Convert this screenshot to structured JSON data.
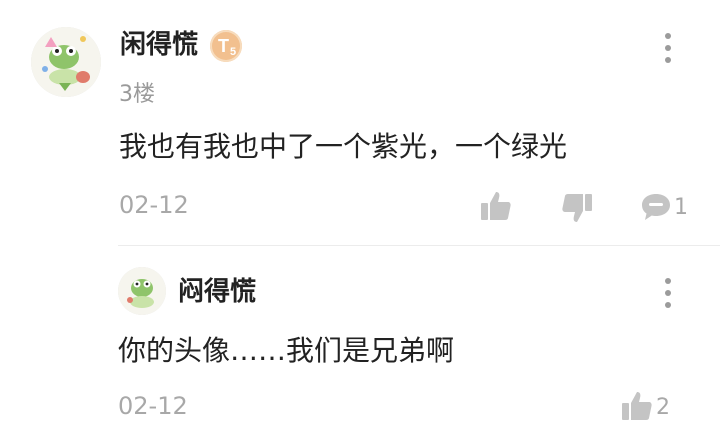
{
  "post": {
    "author": "闲得慌",
    "badge_letter": "T",
    "badge_level": "5",
    "floor": "3楼",
    "content": "我也有我也中了一个紫光，一个绿光",
    "date": "02-12",
    "reply_count": "1"
  },
  "reply": {
    "author": "闷得慌",
    "content": "你的头像……我们是兄弟啊",
    "date": "02-12",
    "like_count": "2"
  },
  "icons": {
    "more": "more-vertical-icon",
    "like": "thumbs-up-icon",
    "dislike": "thumbs-down-icon",
    "comment": "comment-bubble-icon"
  },
  "colors": {
    "icon_gray": "#c4c4c4",
    "badge": "#f2c08f",
    "meta_text": "#a8a8a8"
  }
}
